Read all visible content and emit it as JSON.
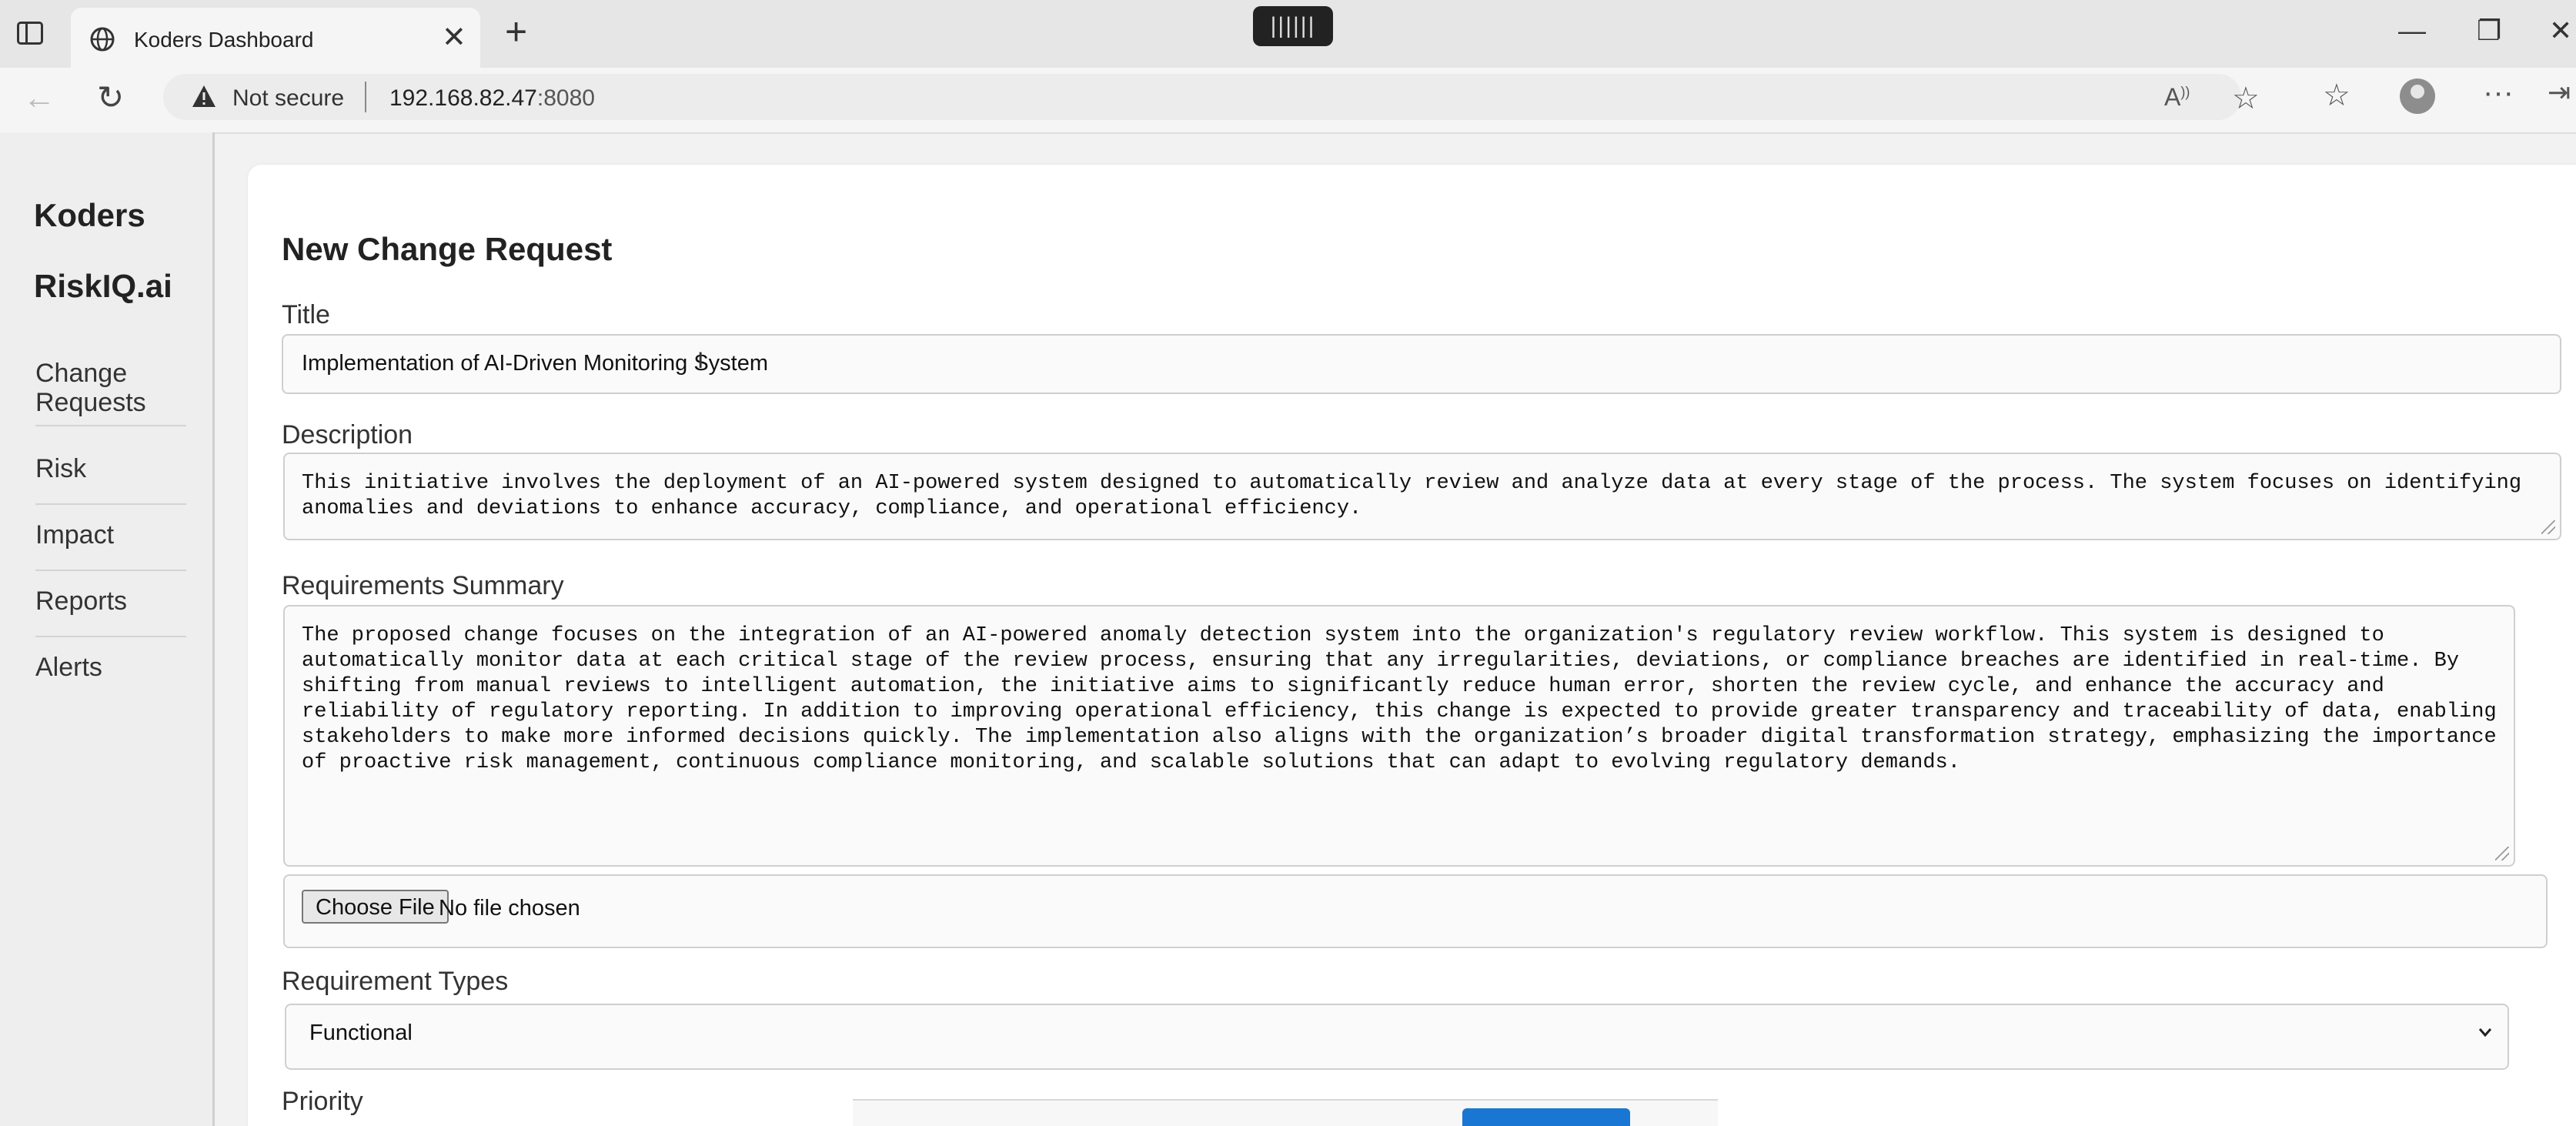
{
  "browser": {
    "tab_title": "Koders Dashboard",
    "security_label": "Not secure",
    "url_host": "192.168.82.47",
    "url_port": ":8080"
  },
  "sidebar": {
    "brand_line1": "Koders",
    "brand_line2": "RiskIQ.ai",
    "items": [
      {
        "label": "Change\nRequests"
      },
      {
        "label": "Risk"
      },
      {
        "label": "Impact"
      },
      {
        "label": "Reports"
      },
      {
        "label": "Alerts"
      }
    ]
  },
  "form": {
    "heading": "New Change Request",
    "title_label": "Title",
    "title_value": "Implementation of AI-Driven Monitoring System",
    "description_label": "Description",
    "description_value": "This initiative involves the deployment of an AI-powered system designed to automatically review and analyze data at every stage of the process. The system focuses on identifying\nanomalies and deviations to enhance accuracy, compliance, and operational efficiency.",
    "requirements_label": "Requirements Summary",
    "requirements_value": "The proposed change focuses on the integration of an AI-powered anomaly detection system into the organization's regulatory review workflow. This system is designed to\nautomatically monitor data at each critical stage of the review process, ensuring that any irregularities, deviations, or compliance breaches are identified in real-time. By\nshifting from manual reviews to intelligent automation, the initiative aims to significantly reduce human error, shorten the review cycle, and enhance the accuracy and\nreliability of regulatory reporting. In addition to improving operational efficiency, this change is expected to provide greater transparency and traceability of data, enabling\nstakeholders to make more informed decisions quickly. The implementation also aligns with the organization’s broader digital transformation strategy, emphasizing the importance\nof proactive risk management, continuous compliance monitoring, and scalable solutions that can adapt to evolving regulatory demands.",
    "file_button_label": "Choose File",
    "file_status": "No file chosen",
    "req_types_label": "Requirement Types",
    "req_types_value": "Functional",
    "priority_label": "Priority"
  }
}
